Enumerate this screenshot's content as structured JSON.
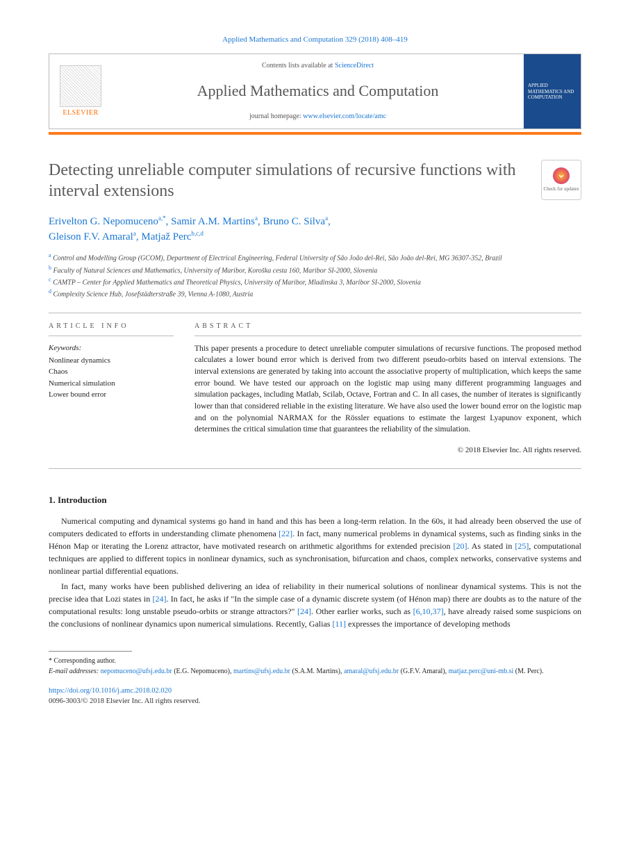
{
  "citation": "Applied Mathematics and Computation 329 (2018) 408–419",
  "header": {
    "contents_prefix": "Contents lists available at ",
    "contents_link": "ScienceDirect",
    "journal": "Applied Mathematics and Computation",
    "homepage_prefix": "journal homepage: ",
    "homepage_link": "www.elsevier.com/locate/amc",
    "publisher": "ELSEVIER",
    "cover_text": "APPLIED MATHEMATICS AND COMPUTATION"
  },
  "check_updates": "Check for updates",
  "title": "Detecting unreliable computer simulations of recursive functions with interval extensions",
  "authors_line1": "Erivelton G. Nepomuceno",
  "authors_sup1": "a,*",
  "authors_sep1": ", ",
  "authors_line1b": "Samir A.M. Martins",
  "authors_sup1b": "a",
  "authors_sep1b": ", ",
  "authors_line1c": "Bruno C. Silva",
  "authors_sup1c": "a",
  "authors_sep1c": ",",
  "authors_line2a": "Gleison F.V. Amaral",
  "authors_sup2a": "a",
  "authors_sep2a": ", ",
  "authors_line2b": "Matjaž Perc",
  "authors_sup2b": "b,c,d",
  "affiliations": {
    "a": "Control and Modelling Group (GCOM), Department of Electrical Engineering, Federal University of São João del-Rei, São João del-Rei, MG 36307-352, Brazil",
    "b": "Faculty of Natural Sciences and Mathematics, University of Maribor, Koroška cesta 160, Maribor SI-2000, Slovenia",
    "c": "CAMTP – Center for Applied Mathematics and Theoretical Physics, University of Maribor, Mladinska 3, Maribor SI-2000, Slovenia",
    "d": "Complexity Science Hub, Josefstädterstraße 39, Vienna A-1080, Austria"
  },
  "article_info_head": "ARTICLE INFO",
  "abstract_head": "ABSTRACT",
  "keywords_label": "Keywords:",
  "keywords": [
    "Nonlinear dynamics",
    "Chaos",
    "Numerical simulation",
    "Lower bound error"
  ],
  "abstract": "This paper presents a procedure to detect unreliable computer simulations of recursive functions. The proposed method calculates a lower bound error which is derived from two different pseudo-orbits based on interval extensions. The interval extensions are generated by taking into account the associative property of multiplication, which keeps the same error bound. We have tested our approach on the logistic map using many different programming languages and simulation packages, including Matlab, Scilab, Octave, Fortran and C. In all cases, the number of iterates is significantly lower than that considered reliable in the existing literature. We have also used the lower bound error on the logistic map and on the polynomial NARMAX for the Rössler equations to estimate the largest Lyapunov exponent, which determines the critical simulation time that guarantees the reliability of the simulation.",
  "copyright": "© 2018 Elsevier Inc. All rights reserved.",
  "section1": "1. Introduction",
  "para1a": "Numerical computing and dynamical systems go hand in hand and this has been a long-term relation. In the 60s, it had already been observed the use of computers dedicated to efforts in understanding climate phenomena ",
  "ref22": "[22]",
  "para1b": ". In fact, many numerical problems in dynamical systems, such as finding sinks in the Hénon Map or iterating the Lorenz attractor, have motivated research on arithmetic algorithms for extended precision ",
  "ref20": "[20]",
  "para1c": ". As stated in ",
  "ref25": "[25]",
  "para1d": ", computational techniques are applied to different topics in nonlinear dynamics, such as synchronisation, bifurcation and chaos, complex networks, conservative systems and nonlinear partial differential equations.",
  "para2a": "In fact, many works have been published delivering an idea of reliability in their numerical solutions of nonlinear dynamical systems. This is not the precise idea that Lozi states in ",
  "ref24a": "[24]",
  "para2b": ". In fact, he asks if \"In the simple case of a dynamic discrete system (of Hénon map) there are doubts as to the nature of the computational results: long unstable pseudo-orbits or strange attractors?\" ",
  "ref24b": "[24]",
  "para2c": ". Other earlier works, such as ",
  "ref61037": "[6,10,37]",
  "para2d": ", have already raised some suspicions on the conclusions of nonlinear dynamics upon numerical simulations. Recently, Galias ",
  "ref11": "[11]",
  "para2e": " expresses the importance of developing methods",
  "footnotes": {
    "corr_label": "* Corresponding author.",
    "email_label": "E-mail addresses:",
    "e1": "nepomuceno@ufsj.edu.br",
    "n1": " (E.G. Nepomuceno), ",
    "e2": "martins@ufsj.edu.br",
    "n2": " (S.A.M. Martins), ",
    "e3": "amaral@ufsj.edu.br",
    "n3": " (G.F.V. Amaral), ",
    "e4": "matjaz.perc@uni-mb.si",
    "n4": " (M. Perc)."
  },
  "doi": "https://doi.org/10.1016/j.amc.2018.02.020",
  "issn_cp": "0096-3003/© 2018 Elsevier Inc. All rights reserved."
}
